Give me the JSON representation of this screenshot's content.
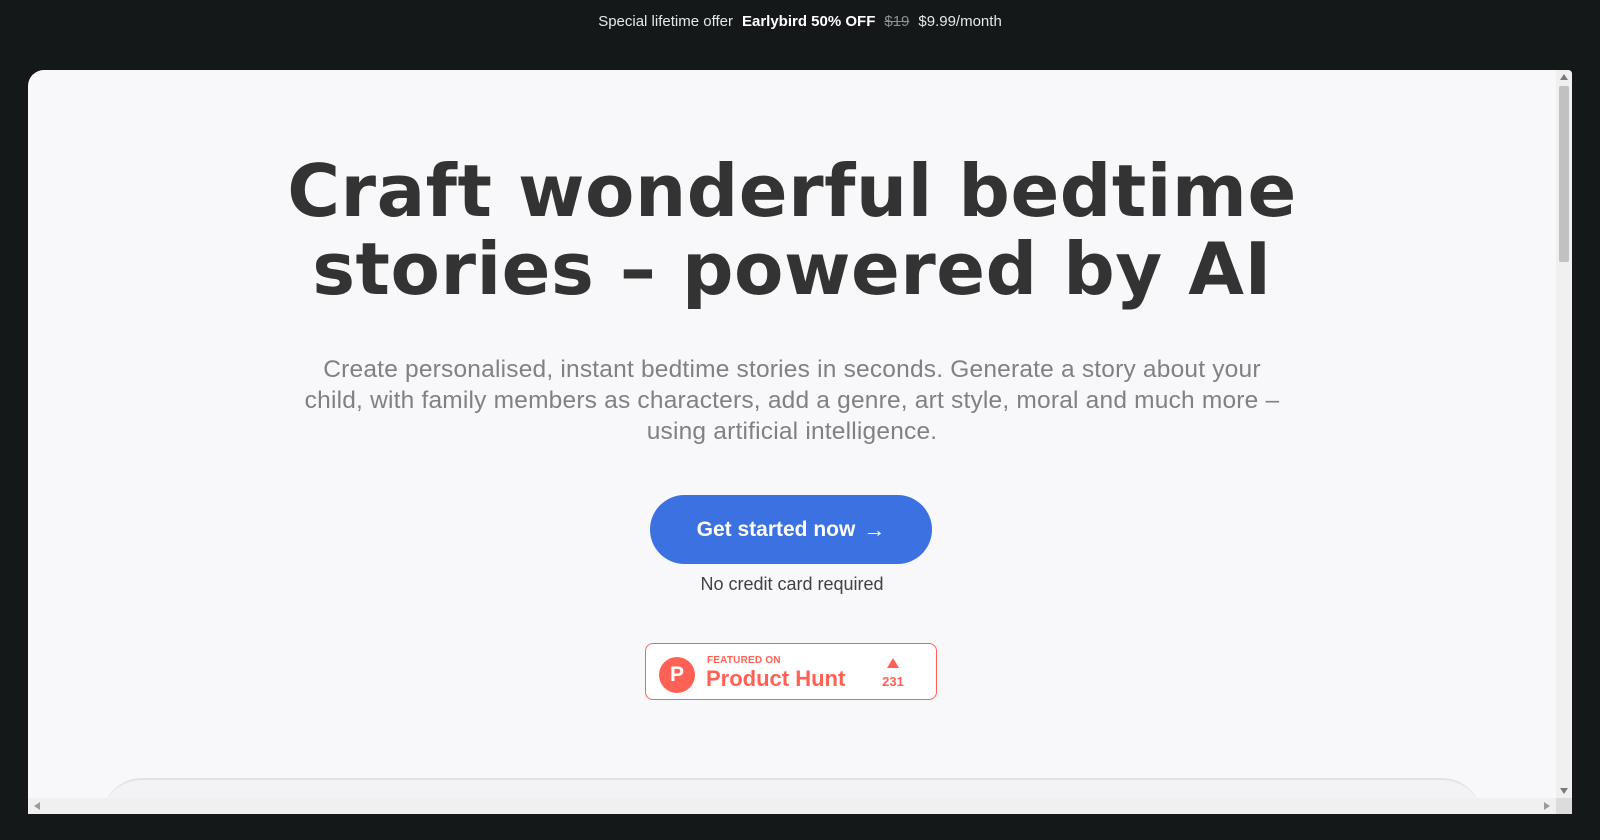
{
  "promo_bar": {
    "label": "Special lifetime offer",
    "offer": "Earlybird 50% OFF",
    "old_price": "$19",
    "new_price": "$9.99/month"
  },
  "hero": {
    "headline_line1": "Craft wonderful bedtime",
    "headline_line2": "stories – powered by AI",
    "subtitle": "Create personalised, instant bedtime stories in seconds. Generate a story about your child, with family members as characters, add a genre, art style, moral and much more – using artificial intelligence.",
    "cta_label": "Get started now",
    "cta_arrow": "→",
    "cta_note": "No credit card required"
  },
  "product_hunt": {
    "featured_label": "FEATURED ON",
    "name": "Product Hunt",
    "logo_letter": "P",
    "upvotes": "231",
    "icon": "upvote-triangle-icon"
  },
  "colors": {
    "page_bg": "#141819",
    "content_bg": "#f8f8fa",
    "cta_bg": "#3b71e0",
    "product_hunt": "#ff6154",
    "headline": "#333333",
    "subtitle": "#7f8185"
  }
}
